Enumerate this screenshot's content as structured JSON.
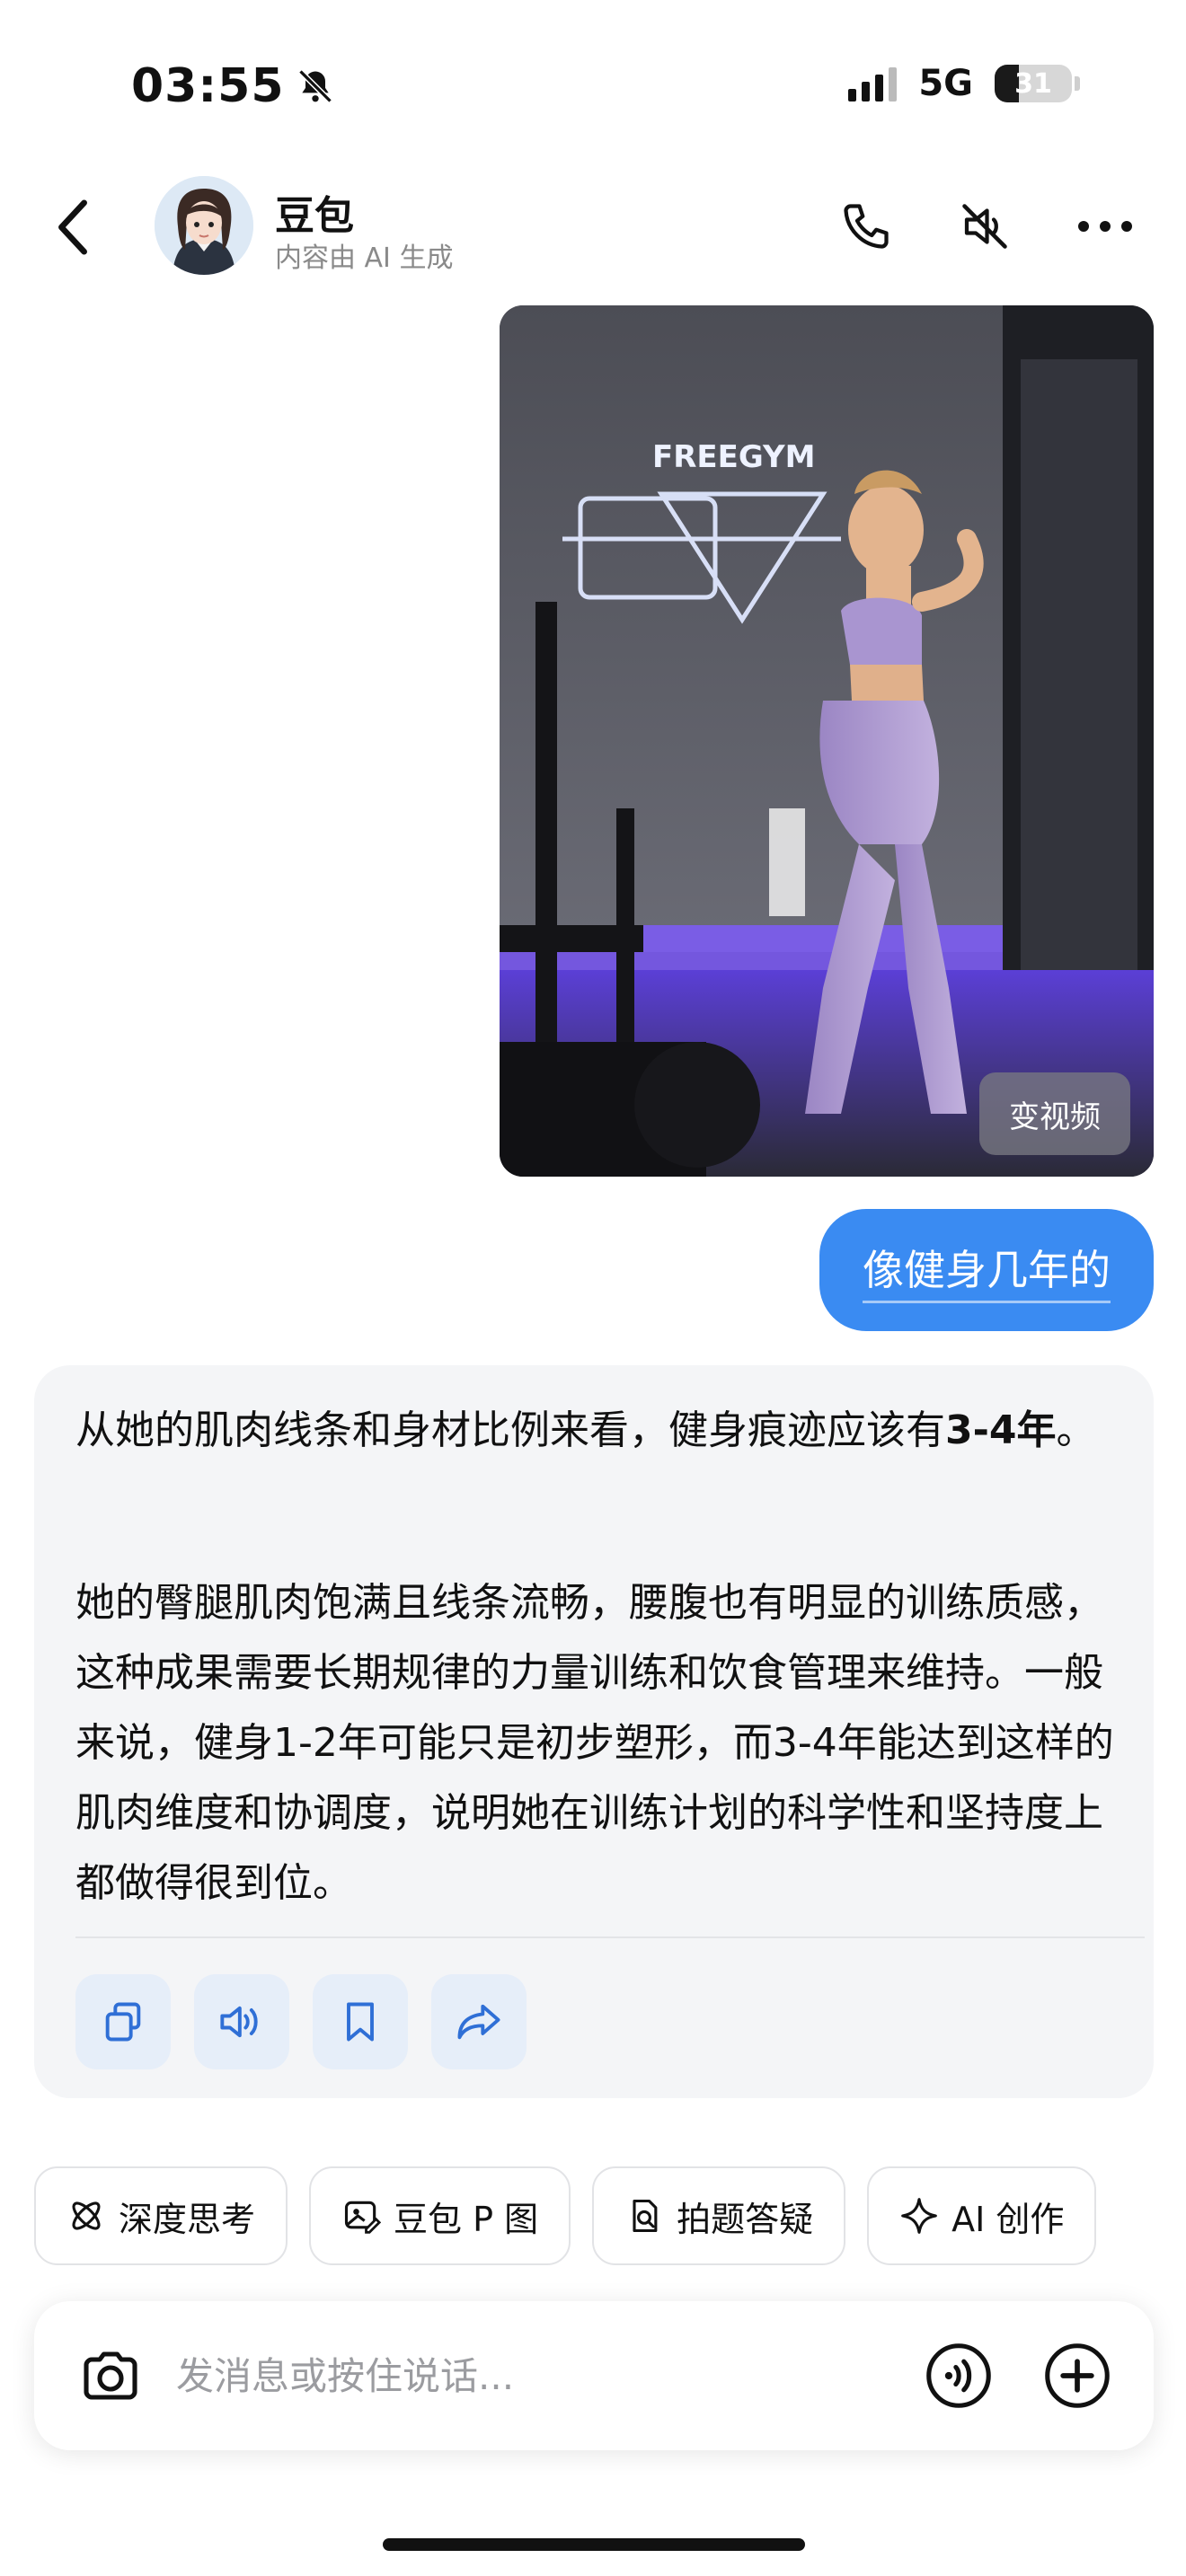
{
  "status_bar": {
    "time": "03:55",
    "network": "5G",
    "battery": "31",
    "battery_level_pct": 31
  },
  "header": {
    "name": "豆包",
    "subtitle": "内容由 AI 生成",
    "icons": [
      "chevron-left-icon",
      "phone-icon",
      "speaker-muted-icon",
      "more-icon"
    ]
  },
  "messages": {
    "image_button": "变视频",
    "user_text": "像健身几年的",
    "ai_para1_a": "从她的肌肉线条和身材比例来看，健身痕迹应该有",
    "ai_para1_b": "3-4年",
    "ai_para1_c": "。",
    "ai_para2": "她的臀腿肌肉饱满且线条流畅，腰腹也有明显的训练质感，这种成果需要长期规律的力量训练和饮食管理来维持。一般来说，健身1-2年可能只是初步塑形，而3-4年能达到这样的肌肉维度和协调度，说明她在训练计划的科学性和坚持度上都做得很到位。",
    "action_icons": [
      "copy-icon",
      "speaker-icon",
      "bookmark-icon",
      "share-icon"
    ]
  },
  "chips": [
    {
      "label": "深度思考",
      "icon": "atom-icon"
    },
    {
      "label": "豆包 P 图",
      "icon": "image-edit-icon"
    },
    {
      "label": "拍题答疑",
      "icon": "scan-question-icon"
    },
    {
      "label": "AI 创作",
      "icon": "sparkle-icon"
    }
  ],
  "input": {
    "placeholder": "发消息或按住说话...",
    "value": ""
  },
  "colors": {
    "accent": "#3a8bf2",
    "card_bg": "#f4f5f7",
    "action_bg": "#e6eef9",
    "subtle_text": "#8a8a8a"
  }
}
